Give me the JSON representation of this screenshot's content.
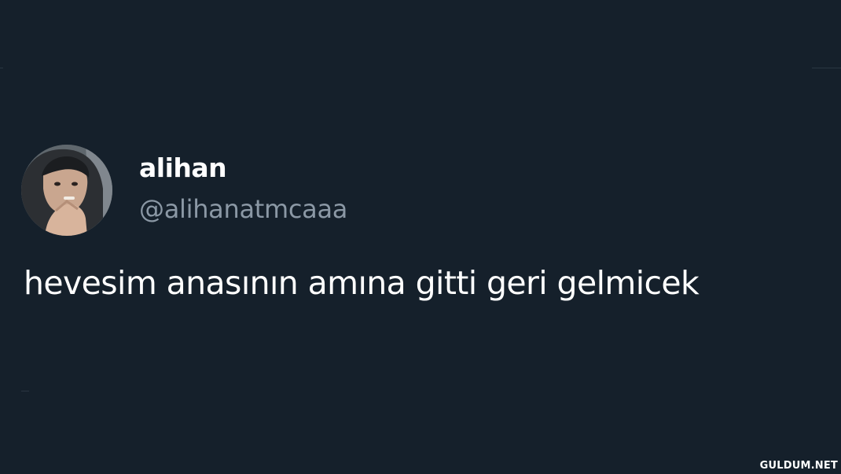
{
  "tweet": {
    "author": {
      "display_name": "alihan",
      "handle": "@alihanatmcaaa",
      "avatar_icon": "profile-photo"
    },
    "text": "hevesim anasının amına gitti geri gelmicek"
  },
  "watermark": {
    "text": "GULDUM.NET"
  },
  "colors": {
    "background": "#15202b",
    "primary_text": "#ffffff",
    "secondary_text": "#8b98a5"
  }
}
